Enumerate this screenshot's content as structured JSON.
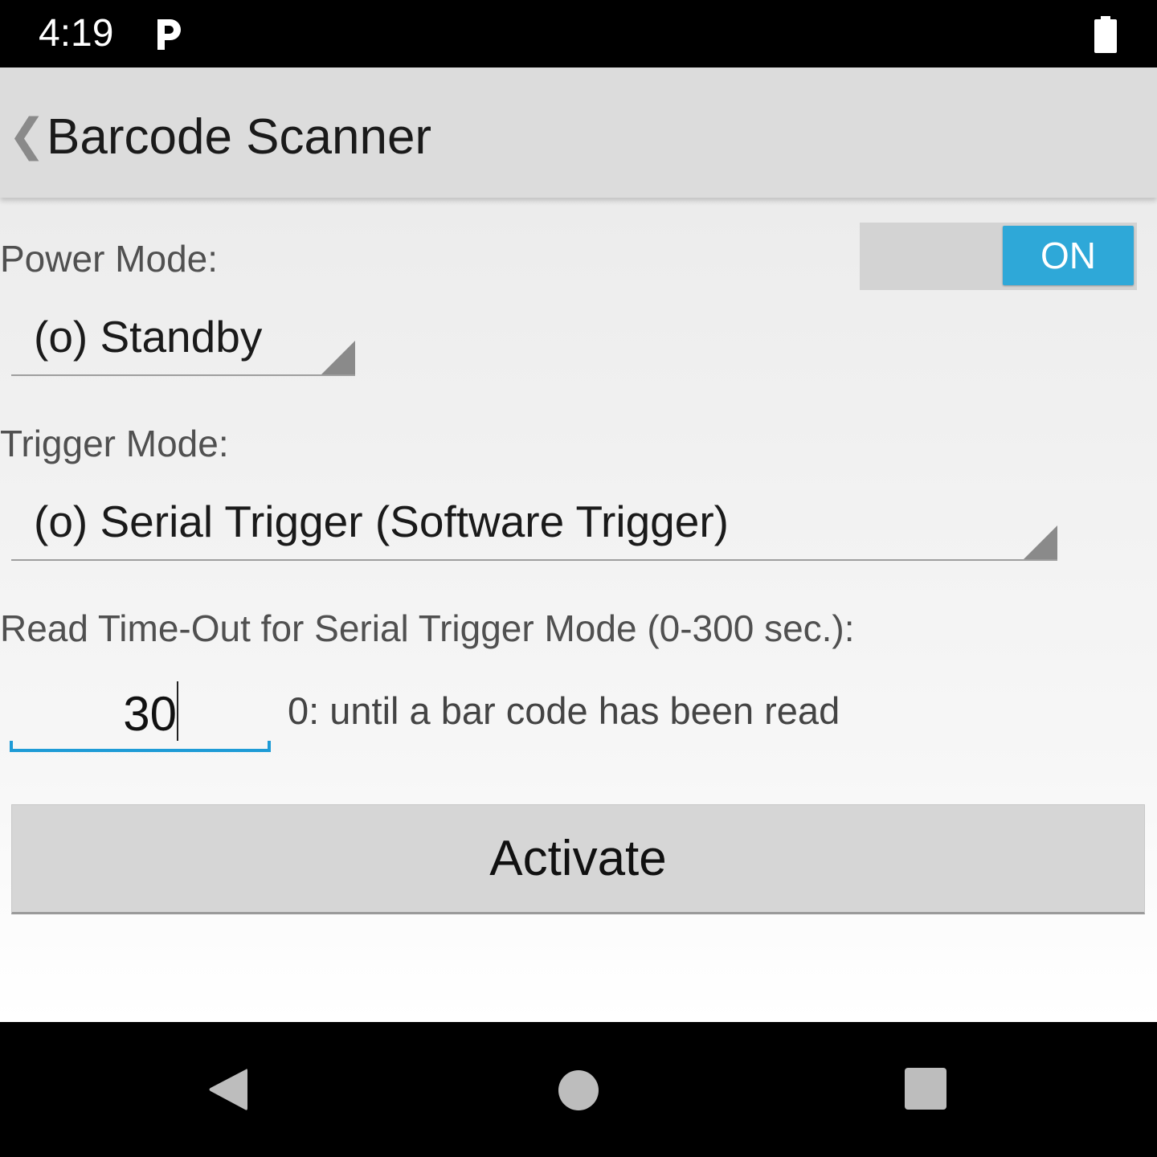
{
  "status_bar": {
    "time": "4:19"
  },
  "app_bar": {
    "back_symbol": "❮",
    "title": "Barcode Scanner"
  },
  "power_mode": {
    "label": "Power Mode:",
    "selected": "(o) Standby",
    "toggle_label": "ON",
    "toggle_color": "#2ea8d8"
  },
  "trigger_mode": {
    "label": "Trigger Mode:",
    "selected": "(o) Serial Trigger (Software Trigger)"
  },
  "read_timeout": {
    "label": "Read Time-Out for Serial Trigger Mode (0-300 sec.):",
    "value": "30",
    "hint": "0: until a bar code has been read"
  },
  "activate_button": {
    "label": "Activate"
  },
  "icons": {
    "status": [
      "p-icon",
      "battery-icon"
    ],
    "nav": [
      "nav-back-icon",
      "nav-home-icon",
      "nav-recents-icon"
    ]
  }
}
